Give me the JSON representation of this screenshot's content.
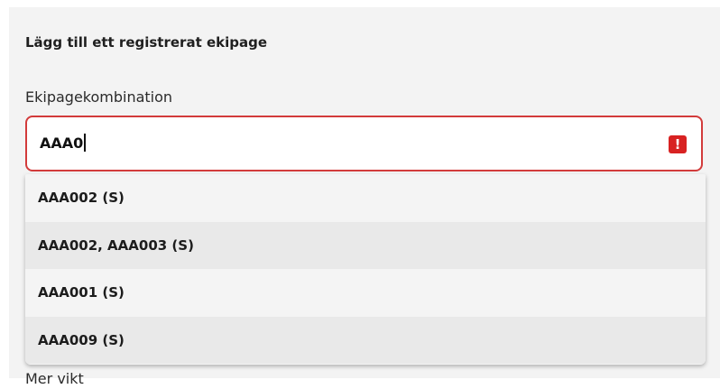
{
  "form": {
    "title": "Lägg till ett registrerat ekipage",
    "combination_label": "Ekipagekombination",
    "combination_value": "AAA0",
    "error_icon_glyph": "!",
    "next_label": "Mer vikt"
  },
  "suggestions": [
    {
      "label": "AAA002 (S)"
    },
    {
      "label": "AAA002, AAA003 (S)"
    },
    {
      "label": "AAA001 (S)"
    },
    {
      "label": "AAA009 (S)"
    }
  ],
  "colors": {
    "error": "#d82222",
    "panel_background": "#f3f3f3"
  }
}
